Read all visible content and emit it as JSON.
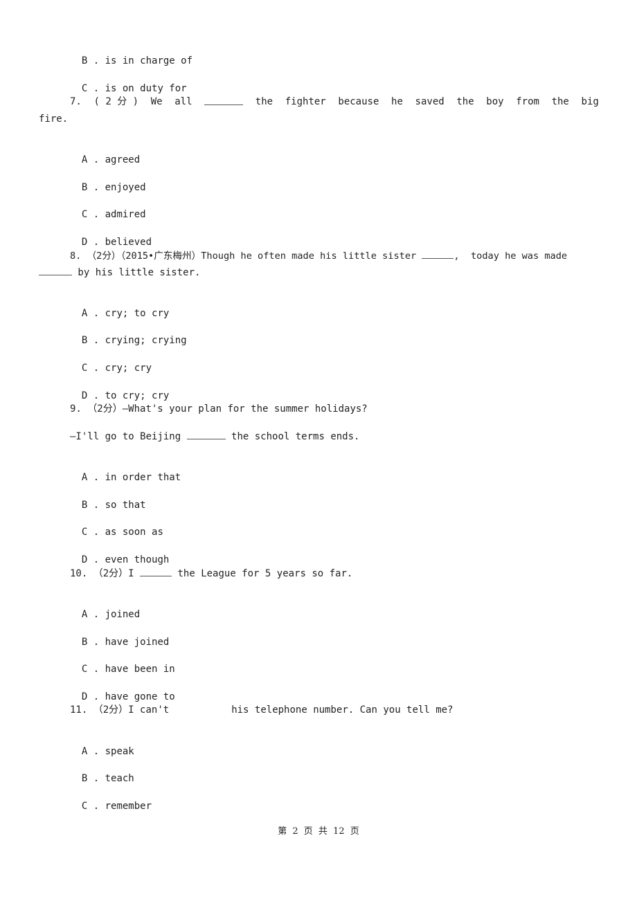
{
  "document": {
    "prev_question_options": [
      {
        "letter": "B .",
        "text": "is in charge of"
      },
      {
        "letter": "C .",
        "text": "is on duty for"
      }
    ],
    "questions": [
      {
        "number": "7.",
        "score": "( 2 分 )",
        "words_before": [
          "We",
          "all"
        ],
        "blank": "_______",
        "words_after": [
          "the",
          "fighter",
          "because",
          "he",
          "saved",
          "the",
          "boy",
          "from",
          "the",
          "big"
        ],
        "continuation": "fire.",
        "options": [
          {
            "letter": "A .",
            "text": "agreed"
          },
          {
            "letter": "B .",
            "text": "enjoyed"
          },
          {
            "letter": "C .",
            "text": "admired"
          },
          {
            "letter": "D .",
            "text": "believed"
          }
        ]
      },
      {
        "number": "8.",
        "score": "（2分）",
        "source": "（2015•广东梅州）",
        "stem_line1_before": "Though he often made his little sister",
        "blank1": "______",
        "stem_line1_after": ",  today he was made",
        "blank2": "______",
        "stem_line2_after": " by his little sister.",
        "options": [
          {
            "letter": "A .",
            "text": "cry; to cry"
          },
          {
            "letter": "B .",
            "text": "crying; crying"
          },
          {
            "letter": "C .",
            "text": "cry; cry"
          },
          {
            "letter": "D .",
            "text": "to cry; cry"
          }
        ]
      },
      {
        "number": "9.",
        "score": "（2分）",
        "stem_line1": "—What's your plan for the summer holidays?",
        "stem_line2_before": "—I'll go to Beijing",
        "blank": "_______",
        "stem_line2_after": "the school terms ends.",
        "options": [
          {
            "letter": "A .",
            "text": "in order that"
          },
          {
            "letter": "B .",
            "text": "so that"
          },
          {
            "letter": "C .",
            "text": "as soon as"
          },
          {
            "letter": "D .",
            "text": "even though"
          }
        ]
      },
      {
        "number": "10.",
        "score": "（2分）",
        "stem_before": "I",
        "blank": "______",
        "stem_after": "the League for 5 years so far.",
        "options": [
          {
            "letter": "A .",
            "text": "joined"
          },
          {
            "letter": "B .",
            "text": "have joined"
          },
          {
            "letter": "C .",
            "text": "have been in"
          },
          {
            "letter": "D .",
            "text": "have gone to"
          }
        ]
      },
      {
        "number": "11.",
        "score": "（2分）",
        "stem_before": "I can't",
        "stem_after": "his telephone number. Can you tell me?",
        "options": [
          {
            "letter": "A .",
            "text": "speak"
          },
          {
            "letter": "B .",
            "text": "teach"
          },
          {
            "letter": "C .",
            "text": "remember"
          }
        ]
      }
    ],
    "footer": {
      "text": "第 2 页 共 12 页"
    }
  }
}
